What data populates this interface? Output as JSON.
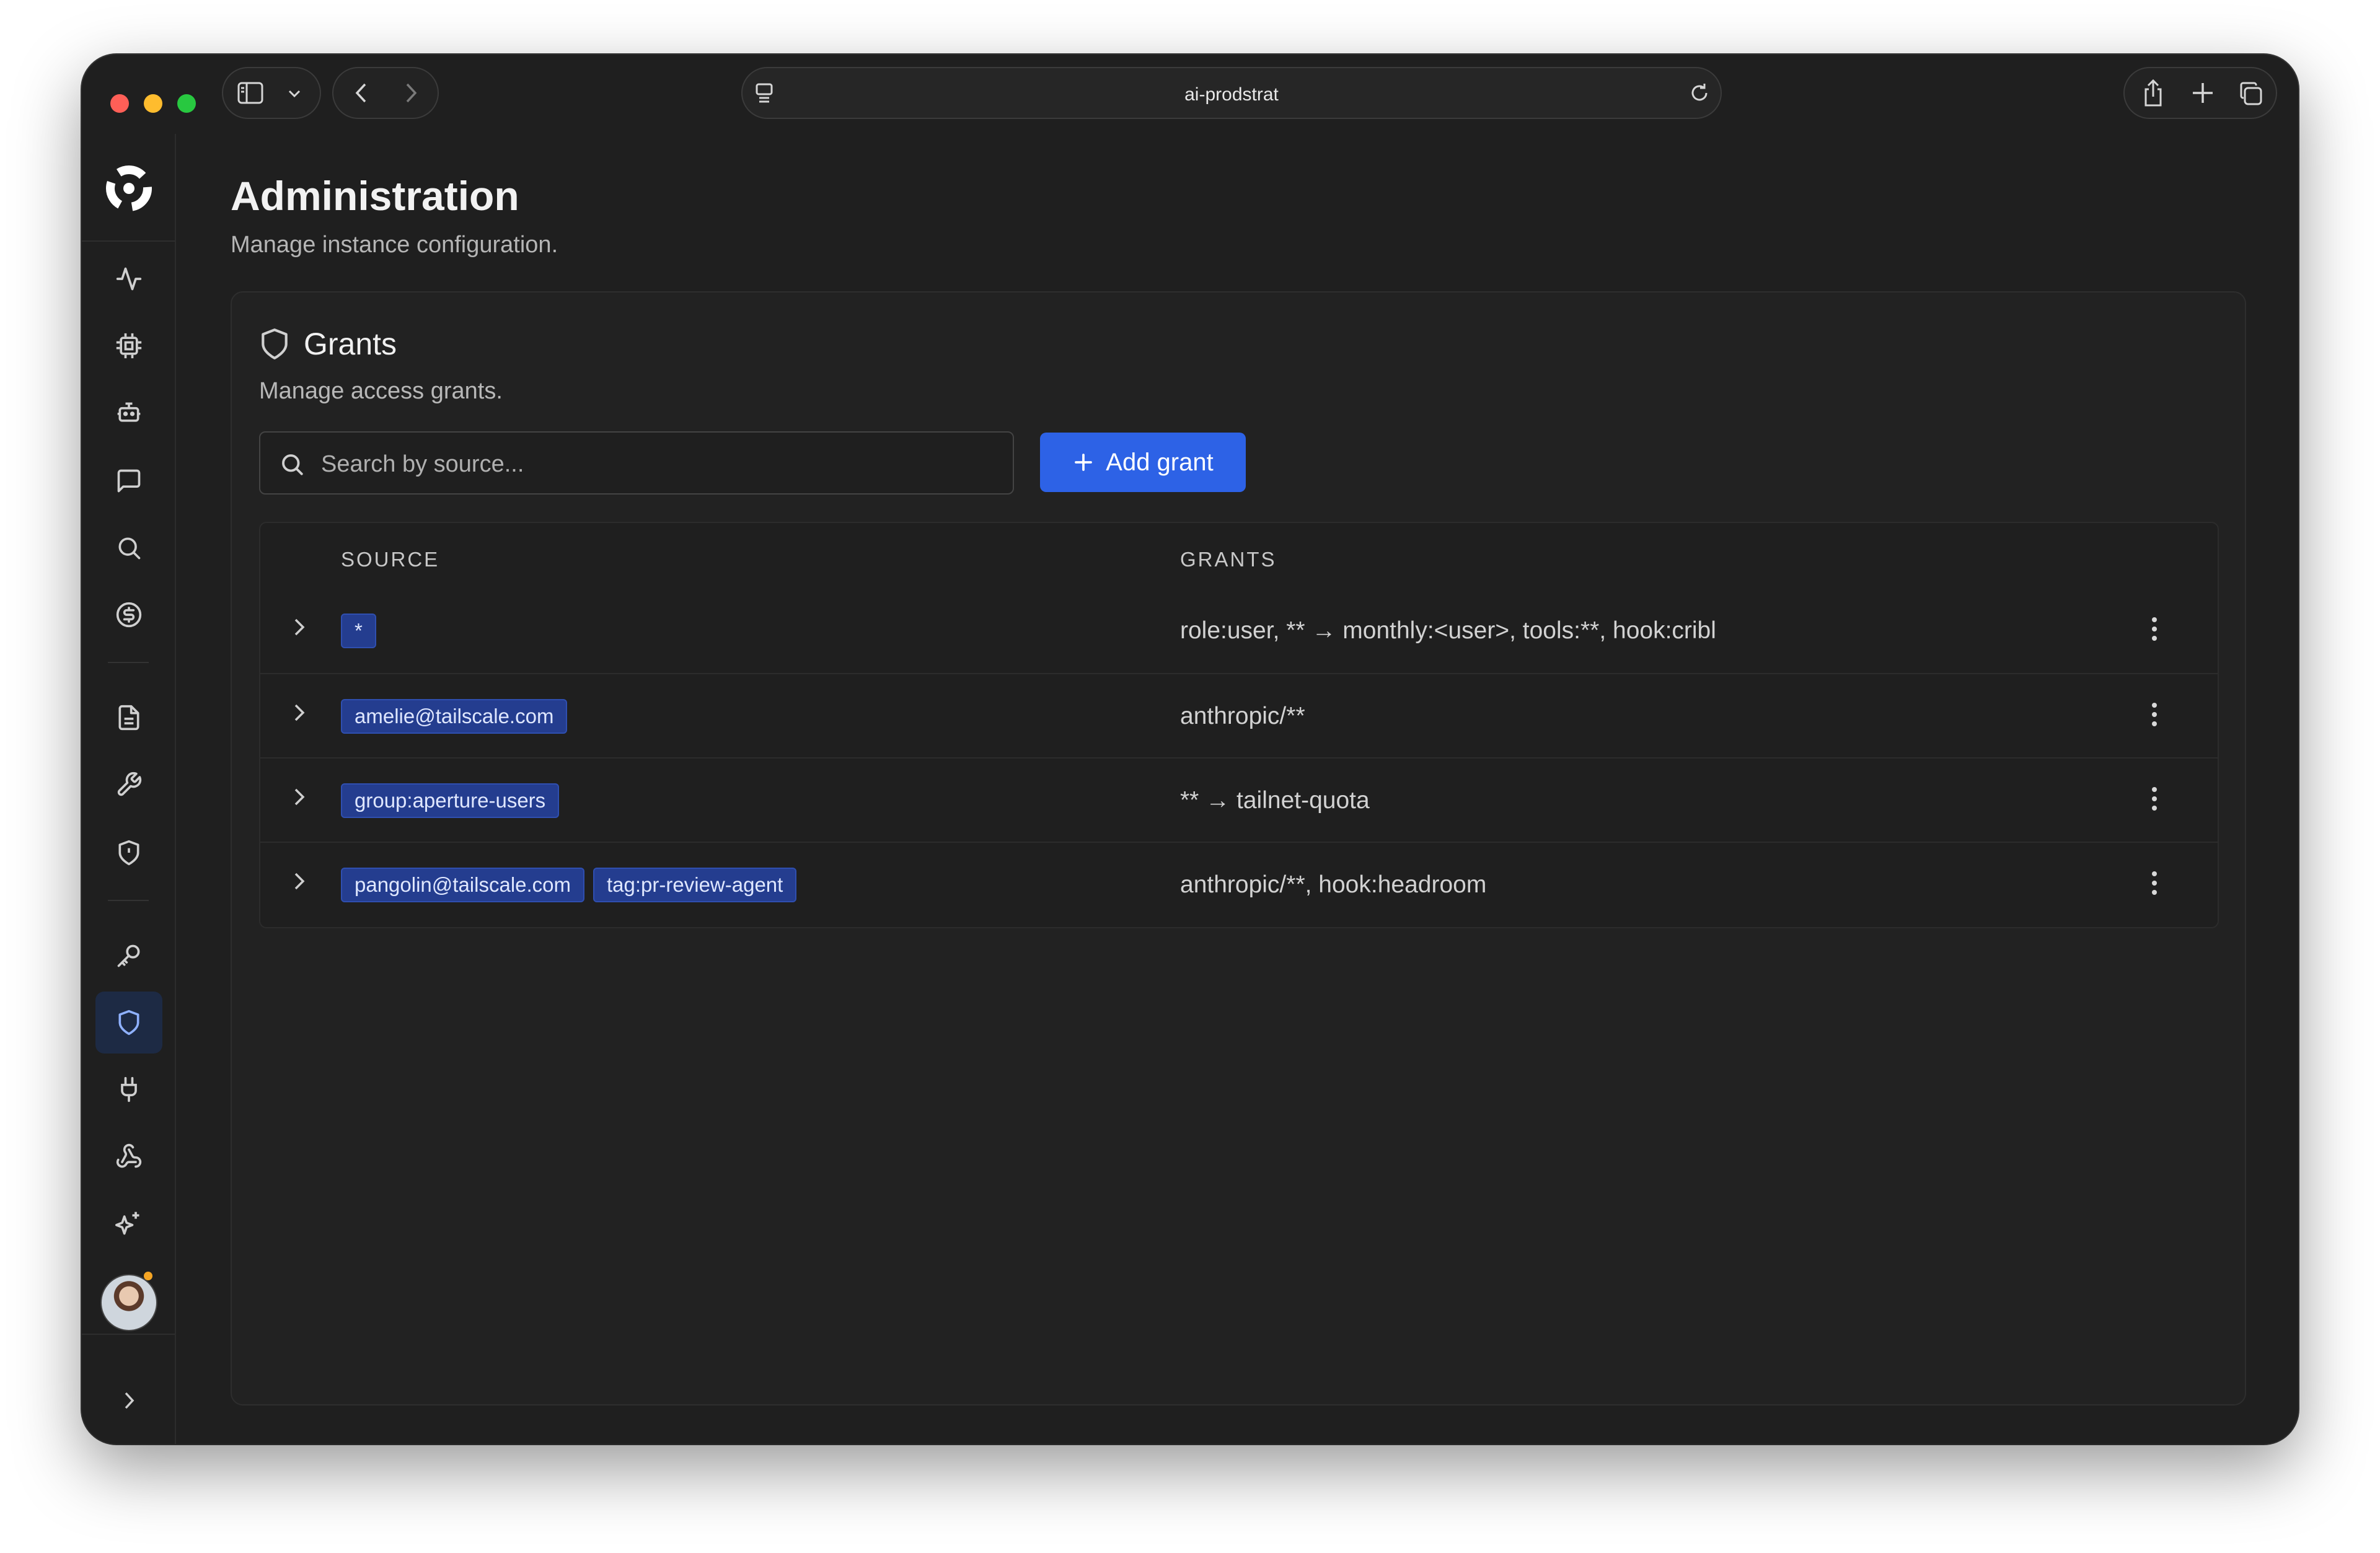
{
  "browser": {
    "url": "ai-prodstrat"
  },
  "sidebar": {
    "items": [
      {
        "name": "activity",
        "icon": "activity-icon"
      },
      {
        "name": "models",
        "icon": "chip-icon"
      },
      {
        "name": "agents",
        "icon": "bot-icon"
      },
      {
        "name": "chats",
        "icon": "message-square-icon"
      },
      {
        "name": "search",
        "icon": "search-icon"
      },
      {
        "name": "billing",
        "icon": "dollar-circle-icon"
      },
      {
        "name": "logs",
        "icon": "file-text-icon"
      },
      {
        "name": "tools",
        "icon": "wrench-icon"
      },
      {
        "name": "security",
        "icon": "shield-alert-icon"
      },
      {
        "name": "keys",
        "icon": "key-icon"
      },
      {
        "name": "grants",
        "icon": "shield-icon",
        "active": true
      },
      {
        "name": "integrations",
        "icon": "plug-icon"
      },
      {
        "name": "webhooks",
        "icon": "webhook-icon"
      },
      {
        "name": "ai-features",
        "icon": "sparkles-icon"
      }
    ]
  },
  "page": {
    "title": "Administration",
    "subtitle": "Manage instance configuration."
  },
  "grants_card": {
    "title": "Grants",
    "subtitle": "Manage access grants.",
    "search_placeholder": "Search by source...",
    "add_button_label": "Add grant",
    "columns": {
      "source": "SOURCE",
      "grants": "GRANTS"
    },
    "rows": [
      {
        "sources": [
          "*"
        ],
        "grants": "role:user, ** → monthly:<user>, tools:**, hook:cribl"
      },
      {
        "sources": [
          "amelie@tailscale.com"
        ],
        "grants": "anthropic/**"
      },
      {
        "sources": [
          "group:aperture-users"
        ],
        "grants": "** → tailnet-quota"
      },
      {
        "sources": [
          "pangolin@tailscale.com",
          "tag:pr-review-agent"
        ],
        "grants": "anthropic/**, hook:headroom"
      }
    ]
  },
  "colors": {
    "background": "#1f1f1f",
    "accent": "#2d62e6",
    "tag_background": "#243d8f",
    "notification_dot": "#f5a524"
  }
}
